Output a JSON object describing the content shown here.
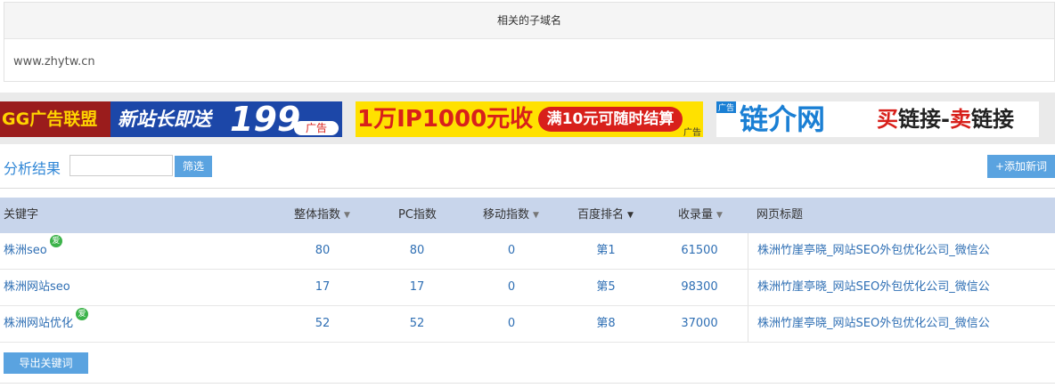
{
  "subdomain": {
    "title": "相关的子域名",
    "domain": "www.zhytw.cn"
  },
  "ads": {
    "ad1": {
      "brand": "GG广告联盟",
      "text": "新站长即送",
      "number": "199",
      "tag": "广告"
    },
    "ad2": {
      "text": "1万IP1000元收",
      "pill": "满10元可随时结算",
      "tag": "广告"
    },
    "ad3": {
      "tag": "广告",
      "name": "链介网",
      "buy": "买",
      "link1": "链接-",
      "sell": "卖",
      "link2": "链接"
    }
  },
  "filter": {
    "title": "分析结果",
    "input_value": "",
    "filter_button": "筛选",
    "add_button": "+添加新词"
  },
  "table": {
    "headers": {
      "keyword": "关键字",
      "overall": "整体指数",
      "pc": "PC指数",
      "mobile": "移动指数",
      "rank": "百度排名",
      "indexed": "收录量",
      "page_title": "网页标题"
    },
    "rows": [
      {
        "keyword": "株洲seo",
        "badge": "爱",
        "overall": "80",
        "pc": "80",
        "mobile": "0",
        "rank": "第1",
        "indexed": "61500",
        "page_title": "株洲竹崖亭晓_网站SEO外包优化公司_微信公"
      },
      {
        "keyword": "株洲网站seo",
        "badge": "",
        "overall": "17",
        "pc": "17",
        "mobile": "0",
        "rank": "第5",
        "indexed": "98300",
        "page_title": "株洲竹崖亭晓_网站SEO外包优化公司_微信公"
      },
      {
        "keyword": "株洲网站优化",
        "badge": "爱",
        "overall": "52",
        "pc": "52",
        "mobile": "0",
        "rank": "第8",
        "indexed": "37000",
        "page_title": "株洲竹崖亭晓_网站SEO外包优化公司_微信公"
      }
    ]
  },
  "export_button": "导出关键词"
}
